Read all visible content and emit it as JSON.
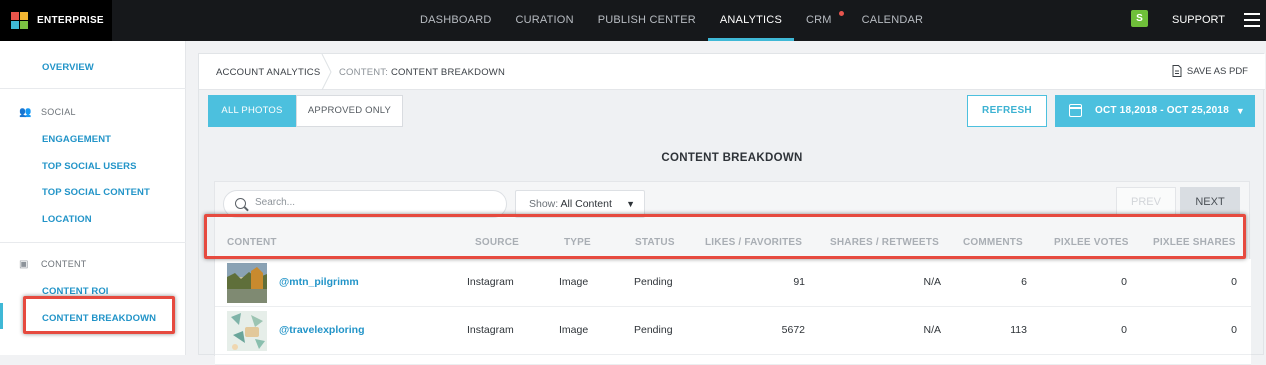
{
  "brand": {
    "name": "ENTERPRISE",
    "logo_colors": [
      "#e8544b",
      "#f2b632",
      "#3fb8d6",
      "#7cc242"
    ]
  },
  "nav": {
    "items": [
      {
        "label": "DASHBOARD"
      },
      {
        "label": "CURATION"
      },
      {
        "label": "PUBLISH CENTER"
      },
      {
        "label": "ANALYTICS",
        "active": true
      },
      {
        "label": "CRM",
        "notification": true
      },
      {
        "label": "CALENDAR"
      }
    ],
    "avatar_letter": "S",
    "support_label": "SUPPORT"
  },
  "sidebar": {
    "overview": "OVERVIEW",
    "social_heading": "SOCIAL",
    "social_items": [
      "ENGAGEMENT",
      "TOP SOCIAL USERS",
      "TOP SOCIAL CONTENT",
      "LOCATION"
    ],
    "content_heading": "CONTENT",
    "content_items": [
      "CONTENT ROI",
      "CONTENT BREAKDOWN"
    ],
    "active_item": "CONTENT BREAKDOWN"
  },
  "breadcrumb": {
    "root": "ACCOUNT ANALYTICS",
    "current_prefix": "CONTENT:",
    "current": "CONTENT BREAKDOWN"
  },
  "save_pdf_label": "SAVE AS PDF",
  "filters": {
    "all_photos": "ALL PHOTOS",
    "approved_only": "APPROVED ONLY",
    "active": "ALL PHOTOS"
  },
  "refresh_label": "REFRESH",
  "date_range": "OCT 18,2018 - OCT 25,2018",
  "section_title": "CONTENT BREAKDOWN",
  "table": {
    "search_placeholder": "Search...",
    "show_label": "Show:",
    "show_value": "All Content",
    "prev_label": "PREV",
    "next_label": "NEXT",
    "columns": [
      "CONTENT",
      "SOURCE",
      "TYPE",
      "STATUS",
      "LIKES / FAVORITES",
      "SHARES / RETWEETS",
      "COMMENTS",
      "PIXLEE VOTES",
      "PIXLEE SHARES"
    ],
    "rows": [
      {
        "user": "@mtn_pilgrimm",
        "source": "Instagram",
        "type": "Image",
        "status": "Pending",
        "likes": "91",
        "shares": "N/A",
        "comments": "6",
        "votes": "0",
        "pshares": "0"
      },
      {
        "user": "@travelexploring",
        "source": "Instagram",
        "type": "Image",
        "status": "Pending",
        "likes": "5672",
        "shares": "N/A",
        "comments": "113",
        "votes": "0",
        "pshares": "0"
      }
    ]
  },
  "accent_color": "#4cc0de",
  "highlight_color": "#e64a3f"
}
